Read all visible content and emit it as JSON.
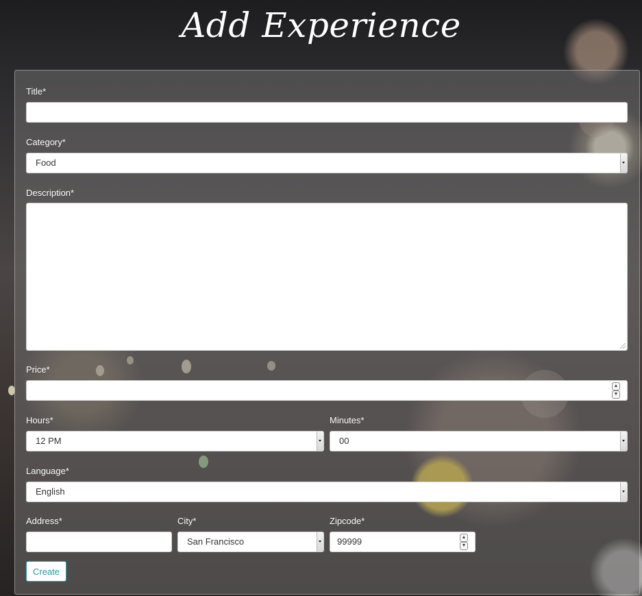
{
  "page": {
    "title": "Add Experience"
  },
  "form": {
    "title_label": "Title*",
    "title_value": "",
    "category_label": "Category*",
    "category_value": "Food",
    "description_label": "Description*",
    "description_value": "",
    "price_label": "Price*",
    "price_value": "",
    "hours_label": "Hours*",
    "hours_value": "12 PM",
    "minutes_label": "Minutes*",
    "minutes_value": "00",
    "language_label": "Language*",
    "language_value": "English",
    "address_label": "Address*",
    "address_value": "",
    "city_label": "City*",
    "city_value": "San Francisco",
    "zipcode_label": "Zipcode*",
    "zipcode_value": "99999",
    "create_label": "Create"
  },
  "icons": {
    "spin_up": "spinner-up-icon",
    "spin_down": "spinner-down-icon",
    "dropdown": "dropdown-caret-icon",
    "resize": "resize-grip-icon"
  }
}
